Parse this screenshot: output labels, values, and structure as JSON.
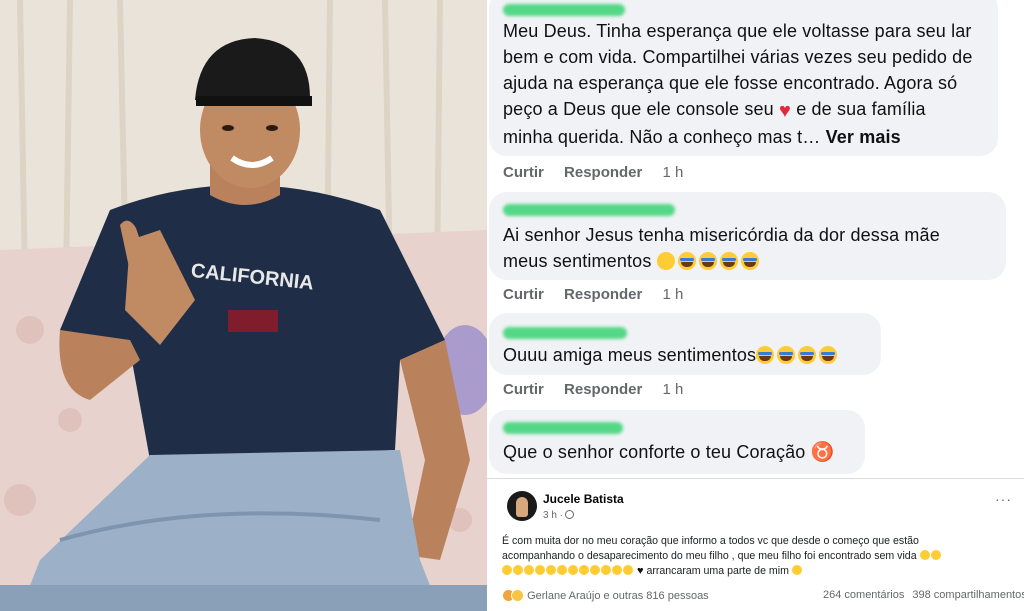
{
  "comments": [
    {
      "text_lines": [
        "Meu Deus. Tinha esperança que ele voltasse para seu lar",
        "bem e com vida. Compartilhei várias vezes seu pedido de",
        "ajuda na esperança que ele fosse encontrado. Agora só",
        "peço a Deus que ele console seu",
        "e de sua família",
        "minha querida. Não a conheço mas t…"
      ],
      "see_more": "Ver mais",
      "like": "Curtir",
      "reply": "Responder",
      "time": "1 h"
    },
    {
      "text_lines": [
        "Ai senhor Jesus tenha misericórdia da dor dessa mãe",
        "meus sentimentos"
      ],
      "like": "Curtir",
      "reply": "Responder",
      "time": "1 h"
    },
    {
      "text_lines": [
        "Ouuu amiga meus sentimentos"
      ],
      "like": "Curtir",
      "reply": "Responder",
      "time": "1 h"
    },
    {
      "text_lines": [
        "Que o senhor conforte o teu Coração"
      ],
      "symbol": "♉"
    }
  ],
  "post": {
    "author": "Jucele Batista",
    "time": "3 h ·",
    "more_icon": "···",
    "text_line1": "É com muita dor no meu coração que informo a todos vc que desde o começo que estão",
    "text_line2": "acompanhando o desaparecimento do meu filho , que meu filho foi encontrado sem vida",
    "text_line3_end": "arrancaram uma parte de mim",
    "reactions_summary": "Gerlane Araújo e outras 816 pessoas",
    "comments_count": "264 comentários",
    "shares_count": "398 compartilhamentos"
  },
  "colors": {
    "bubble_bg": "#f0f2f5",
    "meta_gray": "#65676b",
    "name_redaction": "#4cd681",
    "heart_red": "#e3283c"
  },
  "icons": {
    "heart": "red-heart-emoji",
    "crying": "crying-face-emoji",
    "globe": "globe-icon",
    "taurus": "taurus-symbol"
  }
}
